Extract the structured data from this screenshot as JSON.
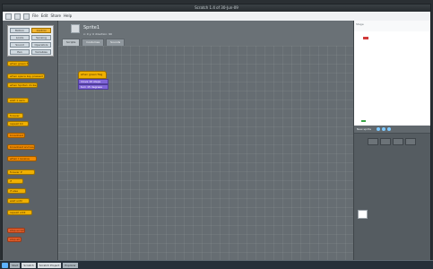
{
  "window": {
    "title": "Scratch 1.4 of 30-Jun-09"
  },
  "menu": {
    "items": [
      "File",
      "Edit",
      "Share",
      "Help"
    ]
  },
  "categories": {
    "items": [
      "Motion",
      "Control",
      "Looks",
      "Sensing",
      "Sound",
      "Operators",
      "Pen",
      "Variables"
    ]
  },
  "palette": {
    "blocks": [
      "when green flag clicked",
      "when space key pressed",
      "when Sprite1 clicked",
      "wait 1 secs",
      "forever",
      "repeat 10",
      "broadcast",
      "broadcast and wait",
      "when I receive",
      "forever if",
      "if",
      "if else",
      "wait until",
      "repeat until",
      "stop script",
      "stop all"
    ]
  },
  "sprite": {
    "name": "Sprite1",
    "meta": "x: 0  y: 0  direction: 90"
  },
  "tabs": [
    "Scripts",
    "Costumes",
    "Sounds"
  ],
  "script": {
    "hat": "when green flag clicked",
    "commands": [
      "move 10 steps",
      "turn 15 degrees"
    ]
  },
  "stage": {
    "title": "Stage"
  },
  "sprite_list": {
    "header": "New sprite"
  },
  "taskbar": {
    "items": [
      "Start",
      "Scratch",
      "Scratch Project",
      "Explorer"
    ]
  }
}
